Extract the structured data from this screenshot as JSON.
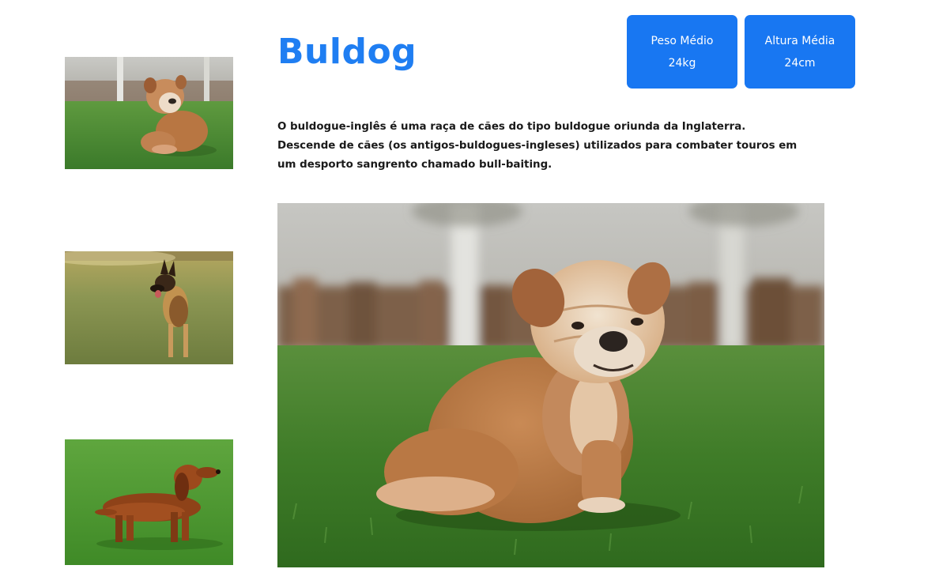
{
  "breed": {
    "title": "Buldog",
    "description_lines": [
      "O buldogue-inglês é uma raça de cães do tipo buldogue oriunda da Inglaterra.",
      "Descende de cães (os antigos-buldogues-ingleses) utilizados para combater touros em",
      "um desporto sangrento chamado bull-baiting."
    ]
  },
  "stats": {
    "weight": {
      "label": "Peso Médio",
      "value": "24kg"
    },
    "height": {
      "label": "Altura Média",
      "value": "24cm"
    }
  },
  "thumbnails": [
    {
      "name": "bulldog-thumbnail",
      "subject": "bulldog puppy on grass"
    },
    {
      "name": "german-shepherd-thumbnail",
      "subject": "german shepherd on field"
    },
    {
      "name": "dachshund-thumbnail",
      "subject": "dachshund on grass"
    }
  ],
  "main_photo": {
    "subject": "bulldog puppy sitting on grass"
  },
  "colors": {
    "accent": "#1877f2",
    "title": "#1f7ef2",
    "text": "#1a1a1a",
    "background": "#ffffff"
  }
}
